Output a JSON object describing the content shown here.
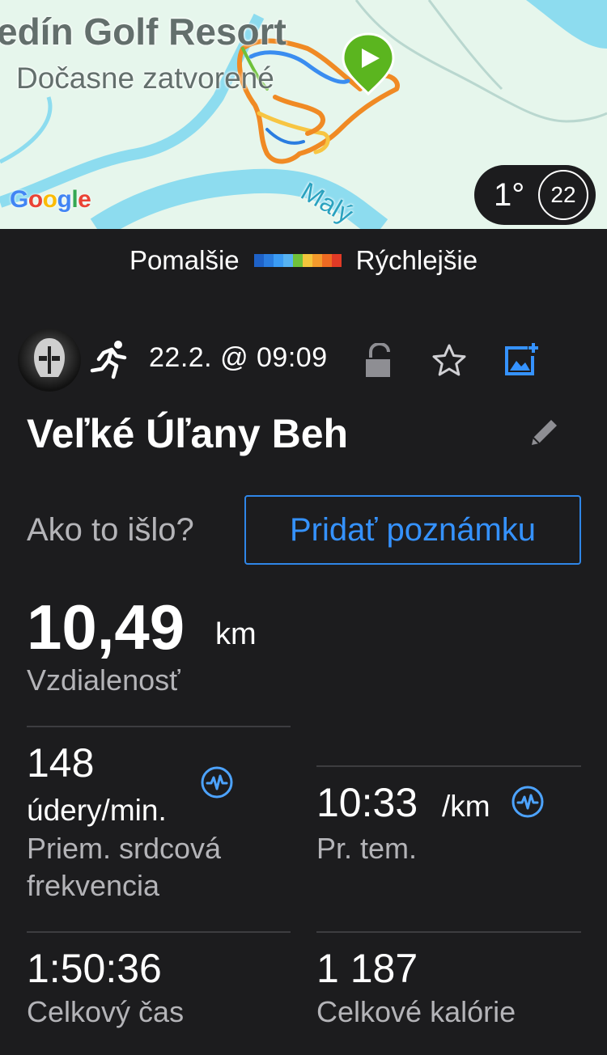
{
  "map": {
    "place_name": "edín Golf Resort",
    "place_status": "Dočasne zatvorené",
    "water_label": "Malý",
    "attribution": "Google",
    "weather_temp": "1°",
    "wind_speed": "22"
  },
  "legend": {
    "slower": "Pomalšie",
    "faster": "Rýchlejšie",
    "colors": [
      "#1e62c8",
      "#2a7de0",
      "#3b9cf5",
      "#57b3f2",
      "#6fc13a",
      "#f2c53c",
      "#f39a2c",
      "#ee6a22",
      "#e03a26"
    ]
  },
  "activity": {
    "date": "22.2. @ 09:09",
    "title": "Veľké Úľany Beh",
    "how_prompt": "Ako to išlo?",
    "add_note": "Pridať poznámku"
  },
  "stats": {
    "distance": {
      "value": "10,49",
      "unit": "km",
      "label": "Vzdialenosť"
    },
    "heart_rate": {
      "value": "148",
      "unit": "údery/min.",
      "label_line1": "Priem. srdcová",
      "label_line2": "frekvencia"
    },
    "pace": {
      "value": "10:33",
      "unit": "/km",
      "label": "Pr. tem."
    },
    "total_time": {
      "value": "1:50:36",
      "label": "Celkový čas"
    },
    "calories": {
      "value": "1 187",
      "label": "Celkové kalórie"
    }
  },
  "colors": {
    "background": "#1c1c1e",
    "accent_blue": "#3592ff",
    "label_gray": "#b4b4b8",
    "icon_blue": "#4da3ff"
  }
}
